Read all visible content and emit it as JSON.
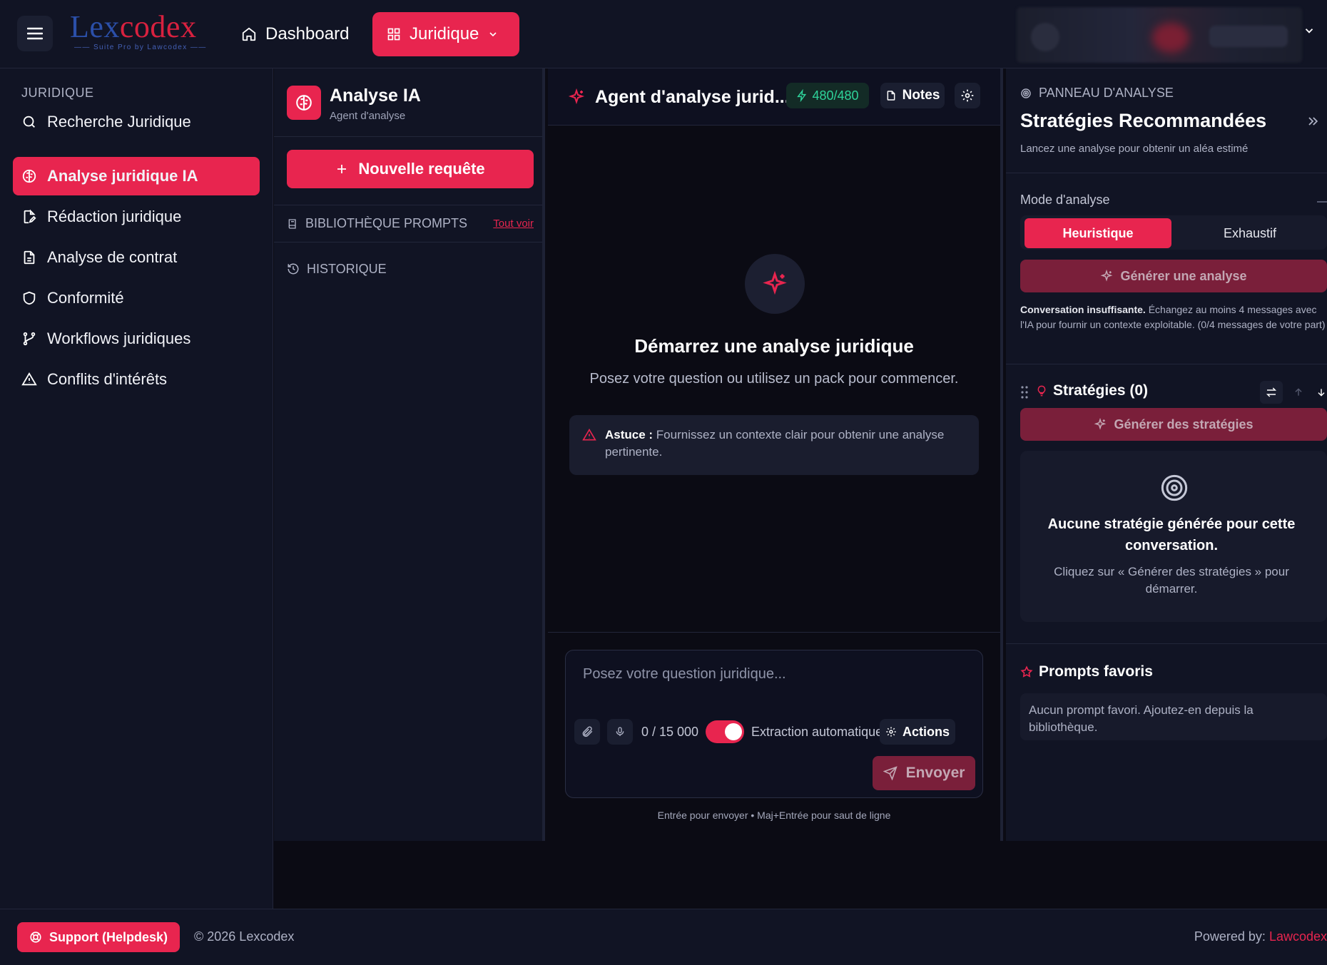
{
  "colors": {
    "accent": "#e8254f",
    "accent_disabled": "#7a1f3a",
    "background": "#0b0b14",
    "surface": "#111424",
    "success": "#2ed39a"
  },
  "topbar": {
    "logo": {
      "word_blue": "Lex",
      "word_red": "codex",
      "tagline": "—— Suite Pro by Lawcodex ——"
    },
    "dashboard_label": "Dashboard",
    "juridique_label": "Juridique"
  },
  "sidebar": {
    "section_title": "JURIDIQUE",
    "items": [
      {
        "label": "Recherche Juridique",
        "icon": "search-icon"
      },
      {
        "label": "Analyse juridique IA",
        "icon": "brain-icon",
        "active": true
      },
      {
        "label": "Rédaction juridique",
        "icon": "file-pen-icon"
      },
      {
        "label": "Analyse de contrat",
        "icon": "file-text-icon"
      },
      {
        "label": "Conformité",
        "icon": "shield-icon"
      },
      {
        "label": "Workflows juridiques",
        "icon": "git-branch-icon"
      },
      {
        "label": "Conflits d'intérêts",
        "icon": "warning-icon"
      }
    ]
  },
  "library": {
    "title": "Analyse IA",
    "subtitle": "Agent d'analyse",
    "new_request": "Nouvelle requête",
    "prompts_section": "BIBLIOTHÈQUE PROMPTS",
    "see_all": "Tout voir",
    "history_section": "HISTORIQUE"
  },
  "chat": {
    "title": "Agent d'analyse jurid...",
    "credits": "480/480",
    "notes_label": "Notes",
    "empty_title": "Démarrez une analyse juridique",
    "empty_subtitle": "Posez votre question ou utilisez un pack pour commencer.",
    "tip_label": "Astuce :",
    "tip_text": " Fournissez un contexte clair pour obtenir une analyse pertinente.",
    "input_placeholder": "Posez votre question juridique...",
    "char_count": "0 / 15 000",
    "auto_extract": "Extraction automatique",
    "auto_extract_on": true,
    "actions_label": "Actions",
    "send_label": "Envoyer",
    "hint": "Entrée pour envoyer • Maj+Entrée pour saut de ligne"
  },
  "panel": {
    "eyebrow": "PANNEAU D'ANALYSE",
    "title": "Stratégies Recommandées",
    "subtitle": "Lancez une analyse pour obtenir un aléa estimé",
    "mode_label": "Mode d'analyse",
    "mode_options": [
      "Heuristique",
      "Exhaustif"
    ],
    "mode_selected": "Heuristique",
    "generate_analysis": "Générer une analyse",
    "insufficient_bold": "Conversation insuffisante.",
    "insufficient_text": " Échangez au moins 4 messages avec l'IA pour fournir un contexte exploitable. (0/4 messages de votre part)",
    "strategies_title": "Stratégies (0)",
    "generate_strategies": "Générer des stratégies",
    "strategies_empty_title": "Aucune stratégie générée pour cette conversation.",
    "strategies_empty_sub": "Cliquez sur « Générer des stratégies » pour démarrer.",
    "favorites_title": "Prompts favoris",
    "favorites_empty": "Aucun prompt favori. Ajoutez-en depuis la bibliothèque."
  },
  "footer": {
    "support_label": "Support (Helpdesk)",
    "copyright": "© 2026 Lexcodex",
    "powered_prefix": "Powered by: ",
    "powered_brand": "Lawcodex"
  }
}
